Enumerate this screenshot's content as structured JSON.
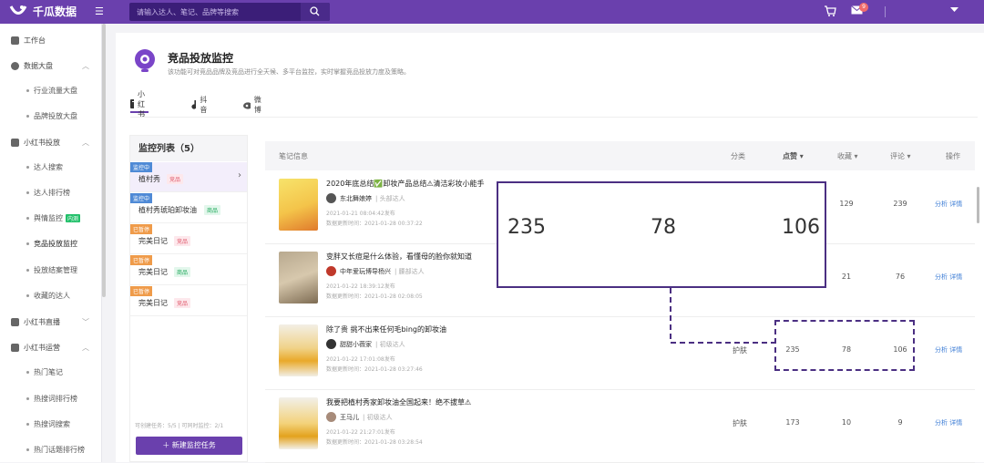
{
  "app": {
    "name": "千瓜数据",
    "search_placeholder": "请输入达人、笔记、品牌等搜索",
    "notification_count": "9"
  },
  "sidebar": {
    "items": [
      {
        "label": "工作台"
      },
      {
        "label": "数据大盘"
      },
      {
        "label": "行业流量大盘"
      },
      {
        "label": "品牌投放大盘"
      },
      {
        "label": "小红书投放"
      },
      {
        "label": "达人搜索"
      },
      {
        "label": "达人排行榜"
      },
      {
        "label": "舆情监控",
        "tag": "内测"
      },
      {
        "label": "竞品投放监控"
      },
      {
        "label": "投放结案管理"
      },
      {
        "label": "收藏的达人"
      },
      {
        "label": "小红书直播"
      },
      {
        "label": "小红书运营"
      },
      {
        "label": "热门笔记"
      },
      {
        "label": "热搜词排行榜"
      },
      {
        "label": "热搜词搜索"
      },
      {
        "label": "热门话题排行榜"
      }
    ]
  },
  "page": {
    "title": "竞品投放监控",
    "description": "该功能可对竞品品牌及竞品进行全天候、多平台监控，实时掌握竞品投放力度及策略。",
    "tabs": [
      "小红书",
      "抖音",
      "微博"
    ]
  },
  "monitor_list": {
    "title": "监控列表（5）",
    "items": [
      {
        "status": "监控中",
        "name": "植村秀",
        "chip": "竞品"
      },
      {
        "status": "监控中",
        "name": "植村秀琥珀卸妆油",
        "chip": "商品"
      },
      {
        "status": "已暂停",
        "name": "完美日记",
        "chip": "竞品"
      },
      {
        "status": "已暂停",
        "name": "完美日记",
        "chip": "商品"
      },
      {
        "status": "已暂停",
        "name": "完美日记",
        "chip": "竞品"
      }
    ],
    "quota": "可创建任务：5/5 | 可同时监控：2/1",
    "new_button": "＋ 新建监控任务"
  },
  "table": {
    "headers": {
      "note": "笔记信息",
      "category": "分类",
      "likes": "点赞 ▾",
      "favorites": "收藏 ▾",
      "comments": "评论 ▾",
      "actions": "操作"
    },
    "rows": [
      {
        "title": "2020年底总结✅卸妆产品总结⚠清洁彩妆小能手",
        "author": "东北舞娘婷",
        "level": "| 头部达人",
        "published": "2021-01-21 08:04:42发布",
        "updated": "数据更新时间：2021-01-28 00:37:22",
        "category": "",
        "likes": "",
        "favorites": "129",
        "comments": "239",
        "analyze": "分析",
        "detail": "详情"
      },
      {
        "title": "变胖又长痘是什么体验，看懂母的脸你就知道",
        "author": "中年爱玩博导杨兴",
        "level": "| 腰部达人",
        "published": "2021-01-22 18:39:12发布",
        "updated": "数据更新时间：2021-01-28 02:08:05",
        "category": "",
        "likes": "",
        "favorites": "21",
        "comments": "76",
        "analyze": "分析",
        "detail": "详情"
      },
      {
        "title": "除了贵 挑不出来任何毛bing的卸妆油",
        "author": "甜甜小薇家",
        "level": "| 初级达人",
        "published": "2021-01-22 17:01:08发布",
        "updated": "数据更新时间：2021-01-28 03:27:46",
        "category": "护肤",
        "likes": "235",
        "favorites": "78",
        "comments": "106",
        "analyze": "分析",
        "detail": "详情"
      },
      {
        "title": "我要把植村秀家卸妆油全国起来！绝不拔草⚠",
        "author": "王马儿",
        "level": "| 初级达人",
        "published": "2021-01-22 21:27:01发布",
        "updated": "数据更新时间：2021-01-28 03:28:54",
        "category": "护肤",
        "likes": "173",
        "favorites": "10",
        "comments": "9",
        "analyze": "分析",
        "detail": "详情"
      }
    ]
  },
  "zoom": {
    "likes": "235",
    "favorites": "78",
    "comments": "106"
  }
}
